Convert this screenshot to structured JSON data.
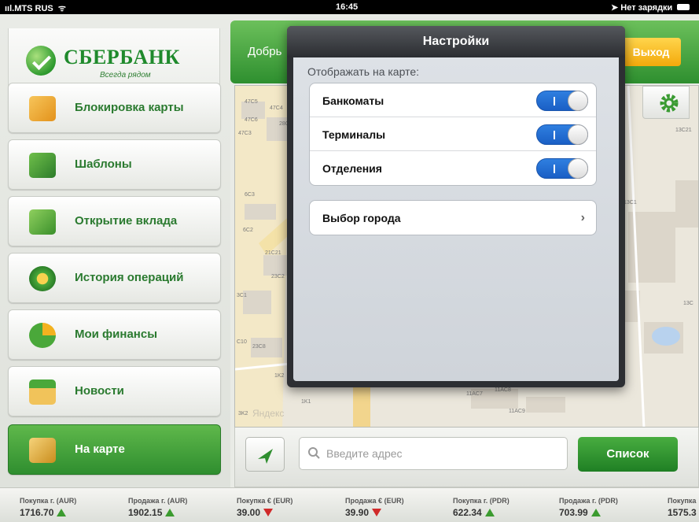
{
  "status": {
    "carrier": "MTS RUS",
    "time": "16:45",
    "battery": "Нет зарядки"
  },
  "logo": {
    "name": "СБЕРБАНК",
    "tagline": "Всегда рядом"
  },
  "sidebar": {
    "items": [
      {
        "label": "Блокировка карты",
        "icon": "lock-card-icon",
        "active": false
      },
      {
        "label": "Шаблоны",
        "icon": "folder-icon",
        "active": false
      },
      {
        "label": "Открытие вклада",
        "icon": "deposit-icon",
        "active": false
      },
      {
        "label": "История операций",
        "icon": "history-icon",
        "active": false
      },
      {
        "label": "Мои финансы",
        "icon": "pie-chart-icon",
        "active": false
      },
      {
        "label": "Новости",
        "icon": "news-icon",
        "active": false
      },
      {
        "label": "На карте",
        "icon": "map-pin-icon",
        "active": true
      }
    ]
  },
  "header": {
    "greeting": "Добрь",
    "exit_label": "Выход"
  },
  "map": {
    "labels": [
      "47C5",
      "47C4",
      "47C6",
      "28C",
      "47C3",
      "6C3",
      "6C2",
      "21C21",
      "23C2",
      "3C1",
      "C10",
      "23C8",
      "1K2",
      "1K1",
      "3K2",
      "Яндекс",
      "11AC7",
      "11AC8",
      "11AC9",
      "13C21",
      "13C1",
      "13C"
    ]
  },
  "search": {
    "placeholder": "Введите адрес",
    "value": ""
  },
  "list_button": "Список",
  "ticker": [
    {
      "label": "Покупка г. (AUR)",
      "value": "1716.70",
      "trend": "up"
    },
    {
      "label": "Продажа г. (AUR)",
      "value": "1902.15",
      "trend": "up"
    },
    {
      "label": "Покупка € (EUR)",
      "value": "39.00",
      "trend": "down"
    },
    {
      "label": "Продажа € (EUR)",
      "value": "39.90",
      "trend": "down"
    },
    {
      "label": "Покупка г. (PDR)",
      "value": "622.34",
      "trend": "up"
    },
    {
      "label": "Продажа г. (PDR)",
      "value": "703.99",
      "trend": "up"
    },
    {
      "label": "Покупка",
      "value": "1575.3",
      "trend": "up"
    }
  ],
  "settings": {
    "title": "Настройки",
    "section": "Отображать на карте:",
    "toggles": [
      {
        "label": "Банкоматы",
        "on": true
      },
      {
        "label": "Терминалы",
        "on": true
      },
      {
        "label": "Отделения",
        "on": true
      }
    ],
    "city_row": "Выбор города"
  },
  "colors": {
    "brand_green": "#2e8f2f",
    "accent_yellow": "#f3a90b",
    "toggle_blue": "#1a5fc5"
  }
}
